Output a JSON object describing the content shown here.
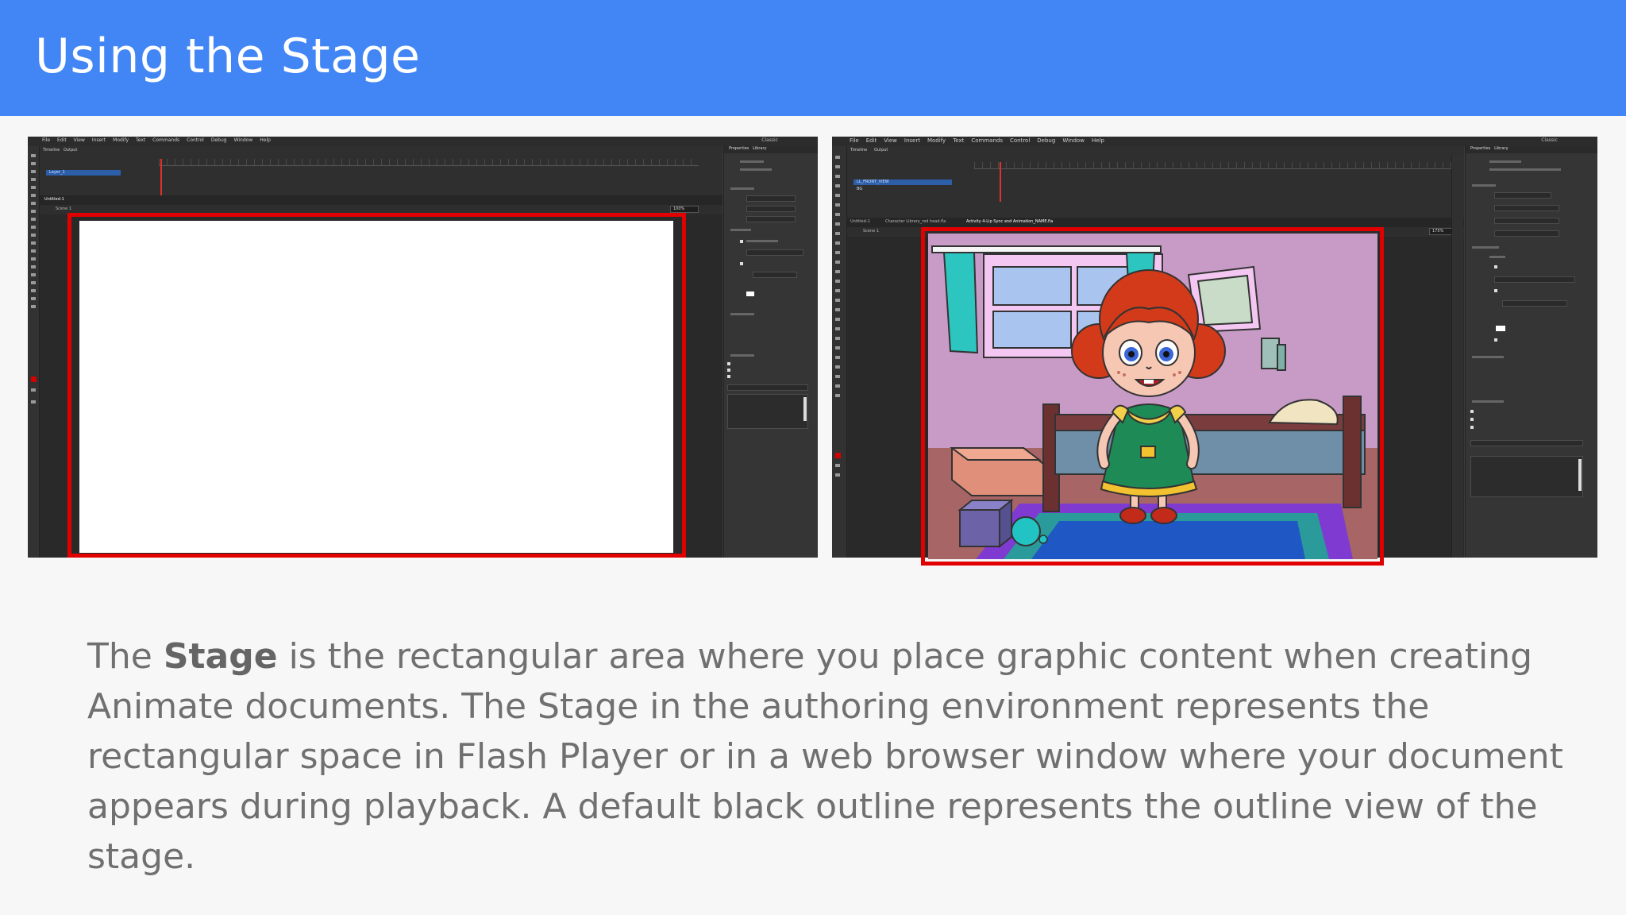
{
  "slide": {
    "title": "Using the Stage"
  },
  "left_screenshot": {
    "menu": [
      "File",
      "Edit",
      "View",
      "Insert",
      "Modify",
      "Text",
      "Commands",
      "Control",
      "Debug",
      "Window",
      "Help"
    ],
    "workspace": "Classic",
    "timeline_tabs": [
      "Timeline",
      "Output"
    ],
    "layer": "Layer_1",
    "document_tab": "Untitled-1",
    "scene": "Scene 1",
    "zoom": "100%",
    "panel_tabs": [
      "Properties",
      "Library"
    ]
  },
  "right_screenshot": {
    "menu": [
      "File",
      "Edit",
      "View",
      "Insert",
      "Modify",
      "Text",
      "Commands",
      "Control",
      "Debug",
      "Window",
      "Help"
    ],
    "workspace": "Classic",
    "timeline_tabs": [
      "Timeline",
      "Output"
    ],
    "layers": [
      "LL_FRONT_VIEW",
      "BG"
    ],
    "document_tabs": [
      "Untitled-1",
      "Character Library_red head.fla",
      "Activity 4-Lip Sync and Animation_NAME.fla"
    ],
    "scene": "Scene 1",
    "zoom": "175%",
    "panel_tabs": [
      "Properties",
      "Library"
    ]
  },
  "description": {
    "before": "The ",
    "bold": "Stage",
    "after": " is the rectangular area where you place graphic content when creating Animate documents. The Stage in the authoring environment represents the rectangular space in Flash Player or in a web browser window where your document appears during playback. A default black outline represents the outline view of the stage."
  },
  "colors": {
    "header": "#4285f4",
    "highlight": "#e00000",
    "app_bg": "#3b3b3b"
  }
}
